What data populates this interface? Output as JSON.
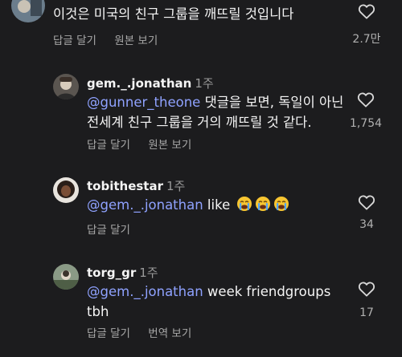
{
  "comments": [
    {
      "username": "",
      "time": "",
      "mention": "",
      "text": "이것은 미국의 친구 그룹을 깨뜨릴 것입니다",
      "text_line2": "",
      "reply_label": "답글 달기",
      "secondary_action": "원본 보기",
      "likes": "2.7만"
    },
    {
      "username": "gem._.jonathan",
      "time": "1주",
      "mention": "@gunner_theone",
      "text": " 댓글을 보면, 독일이 아닌",
      "text_line2": "전세계 친구 그룹을 거의 깨뜨릴 것 같다.",
      "reply_label": "답글 달기",
      "secondary_action": "원본 보기",
      "likes": "1,754"
    },
    {
      "username": "tobithestar",
      "time": "1주",
      "mention": "@gem._.jonathan",
      "text": " like",
      "text_line2": "",
      "reply_label": "답글 달기",
      "secondary_action": "",
      "likes": "34",
      "emojis": [
        "crying-face",
        "crying-face",
        "crying-face"
      ]
    },
    {
      "username": "torg_gr",
      "time": "1주",
      "mention": "@gem._.jonathan",
      "text": " week friendgroups",
      "text_line2": "tbh",
      "reply_label": "답글 달기",
      "secondary_action": "번역 보기",
      "likes": "17"
    }
  ],
  "colors": {
    "background": "#1c1c1e",
    "mention": "#8fa2ff",
    "muted": "#a8a8a8"
  }
}
